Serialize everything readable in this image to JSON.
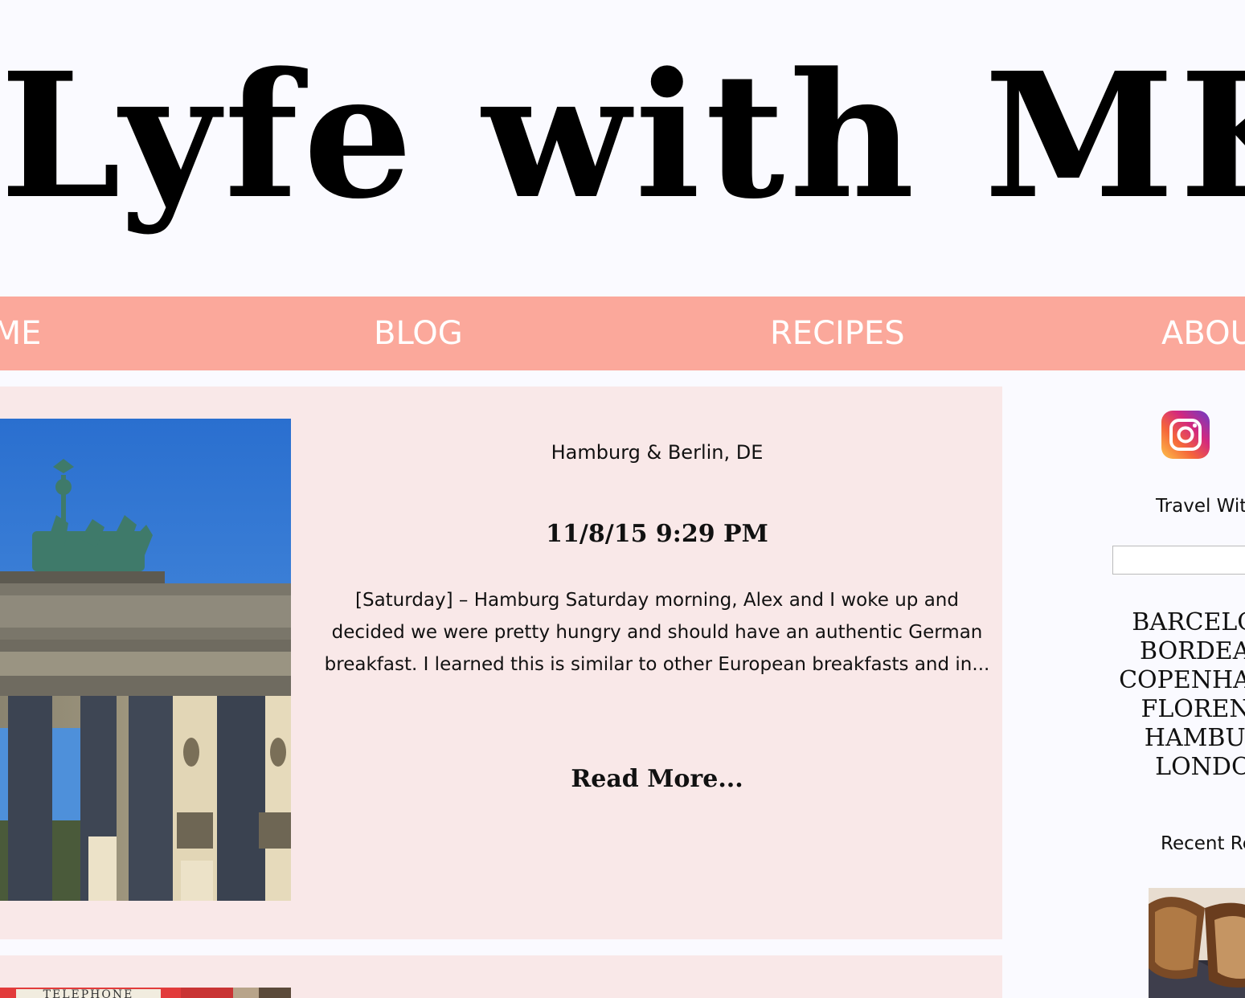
{
  "site": {
    "title": "Lyfe with MK"
  },
  "nav": {
    "items": [
      {
        "label": "HOME"
      },
      {
        "label": "BLOG"
      },
      {
        "label": "RECIPES"
      },
      {
        "label": "ABOUT"
      }
    ]
  },
  "posts": [
    {
      "location": "Hamburg & Berlin, DE",
      "date": "11/8/15 9:29 PM",
      "excerpt": "[Saturday] – Hamburg Saturday morning, Alex and I woke up and decided we were pretty hungry and should have an authentic German breakfast. I learned this is similar to other European breakfasts and in...",
      "read_more": "Read More..."
    },
    {
      "sign_text": "TELEPHONE"
    }
  ],
  "sidebar": {
    "instagram_icon": "instagram-icon",
    "travel_heading": "Travel With",
    "search_placeholder": "",
    "cities": [
      "BARCELONA",
      "BORDEAUX",
      "COPENHAGEN",
      "FLORENCE",
      "HAMBURG",
      "LONDON"
    ],
    "recent_heading": "Recent Recipes"
  },
  "colors": {
    "background": "#fafaff",
    "nav_bg": "#fba89b",
    "nav_text": "#ffffff",
    "card_bg": "#f9e8e8",
    "text": "#111111"
  }
}
